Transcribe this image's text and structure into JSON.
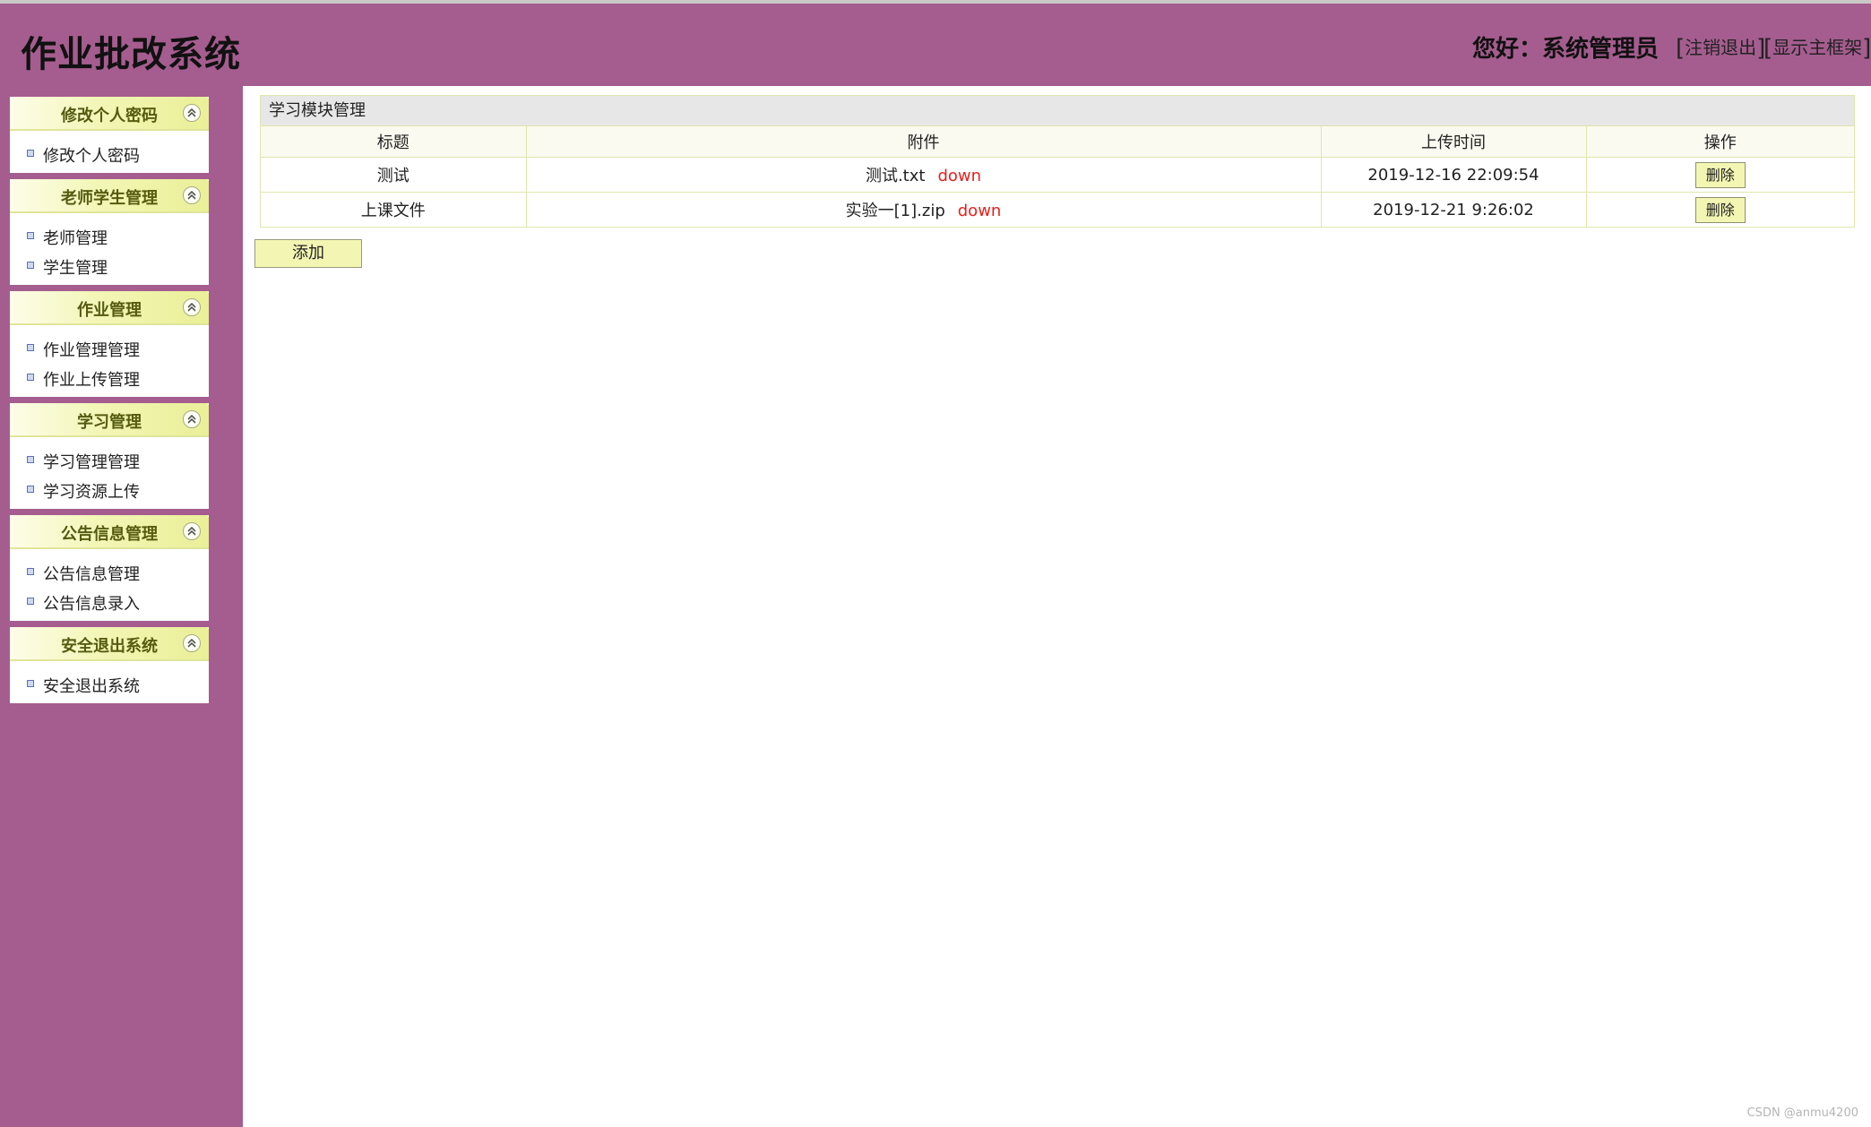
{
  "header": {
    "app_title": "作业批改系统",
    "greeting": "您好：系统管理员",
    "links": [
      "注销退出",
      "显示主框架"
    ]
  },
  "sidebar": {
    "groups": [
      {
        "title": "修改个人密码",
        "items": [
          "修改个人密码"
        ]
      },
      {
        "title": "老师学生管理",
        "items": [
          "老师管理",
          "学生管理"
        ]
      },
      {
        "title": "作业管理",
        "items": [
          "作业管理管理",
          "作业上传管理"
        ]
      },
      {
        "title": "学习管理",
        "items": [
          "学习管理管理",
          "学习资源上传"
        ]
      },
      {
        "title": "公告信息管理",
        "items": [
          "公告信息管理",
          "公告信息录入"
        ]
      },
      {
        "title": "安全退出系统",
        "items": [
          "安全退出系统"
        ]
      }
    ]
  },
  "main": {
    "module_title": "学习模块管理",
    "columns": [
      "标题",
      "附件",
      "上传时间",
      "操作"
    ],
    "rows": [
      {
        "title": "测试",
        "file": "测试.txt",
        "down": "down",
        "time": "2019-12-16 22:09:54",
        "action": "删除"
      },
      {
        "title": "上课文件",
        "file": "实验一[1].zip",
        "down": "down",
        "time": "2019-12-21 9:26:02",
        "action": "删除"
      }
    ],
    "add_label": "添加"
  },
  "watermark": "CSDN @anmu4200",
  "colors": {
    "frame": "#a55d8f",
    "accent_button": "#f3f6b3",
    "down_link": "#e8201a"
  }
}
